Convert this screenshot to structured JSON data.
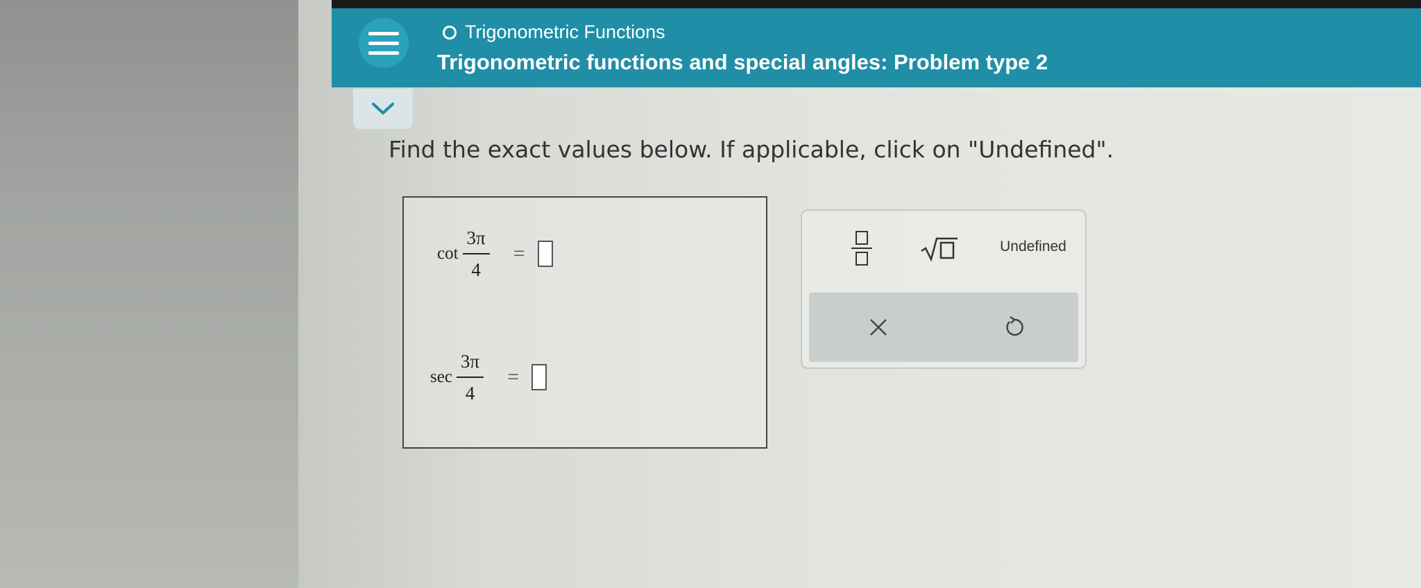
{
  "header": {
    "topic": "Trigonometric Functions",
    "title": "Trigonometric functions and special angles: Problem type 2"
  },
  "main": {
    "instruction": "Find the exact values below. If applicable, click on \"Undefined\"."
  },
  "problems": [
    {
      "function": "cot",
      "numerator": "3π",
      "denominator": "4",
      "equals": "="
    },
    {
      "function": "sec",
      "numerator": "3π",
      "denominator": "4",
      "equals": "="
    }
  ],
  "keypad": {
    "undefined_label": "Undefined"
  },
  "colors": {
    "header": "#1f8ea6",
    "menu_button": "#2ba2bb"
  },
  "icons": [
    "menu-icon",
    "chevron-down-icon",
    "fraction-icon",
    "sqrt-icon",
    "clear-x-icon",
    "reset-icon"
  ]
}
